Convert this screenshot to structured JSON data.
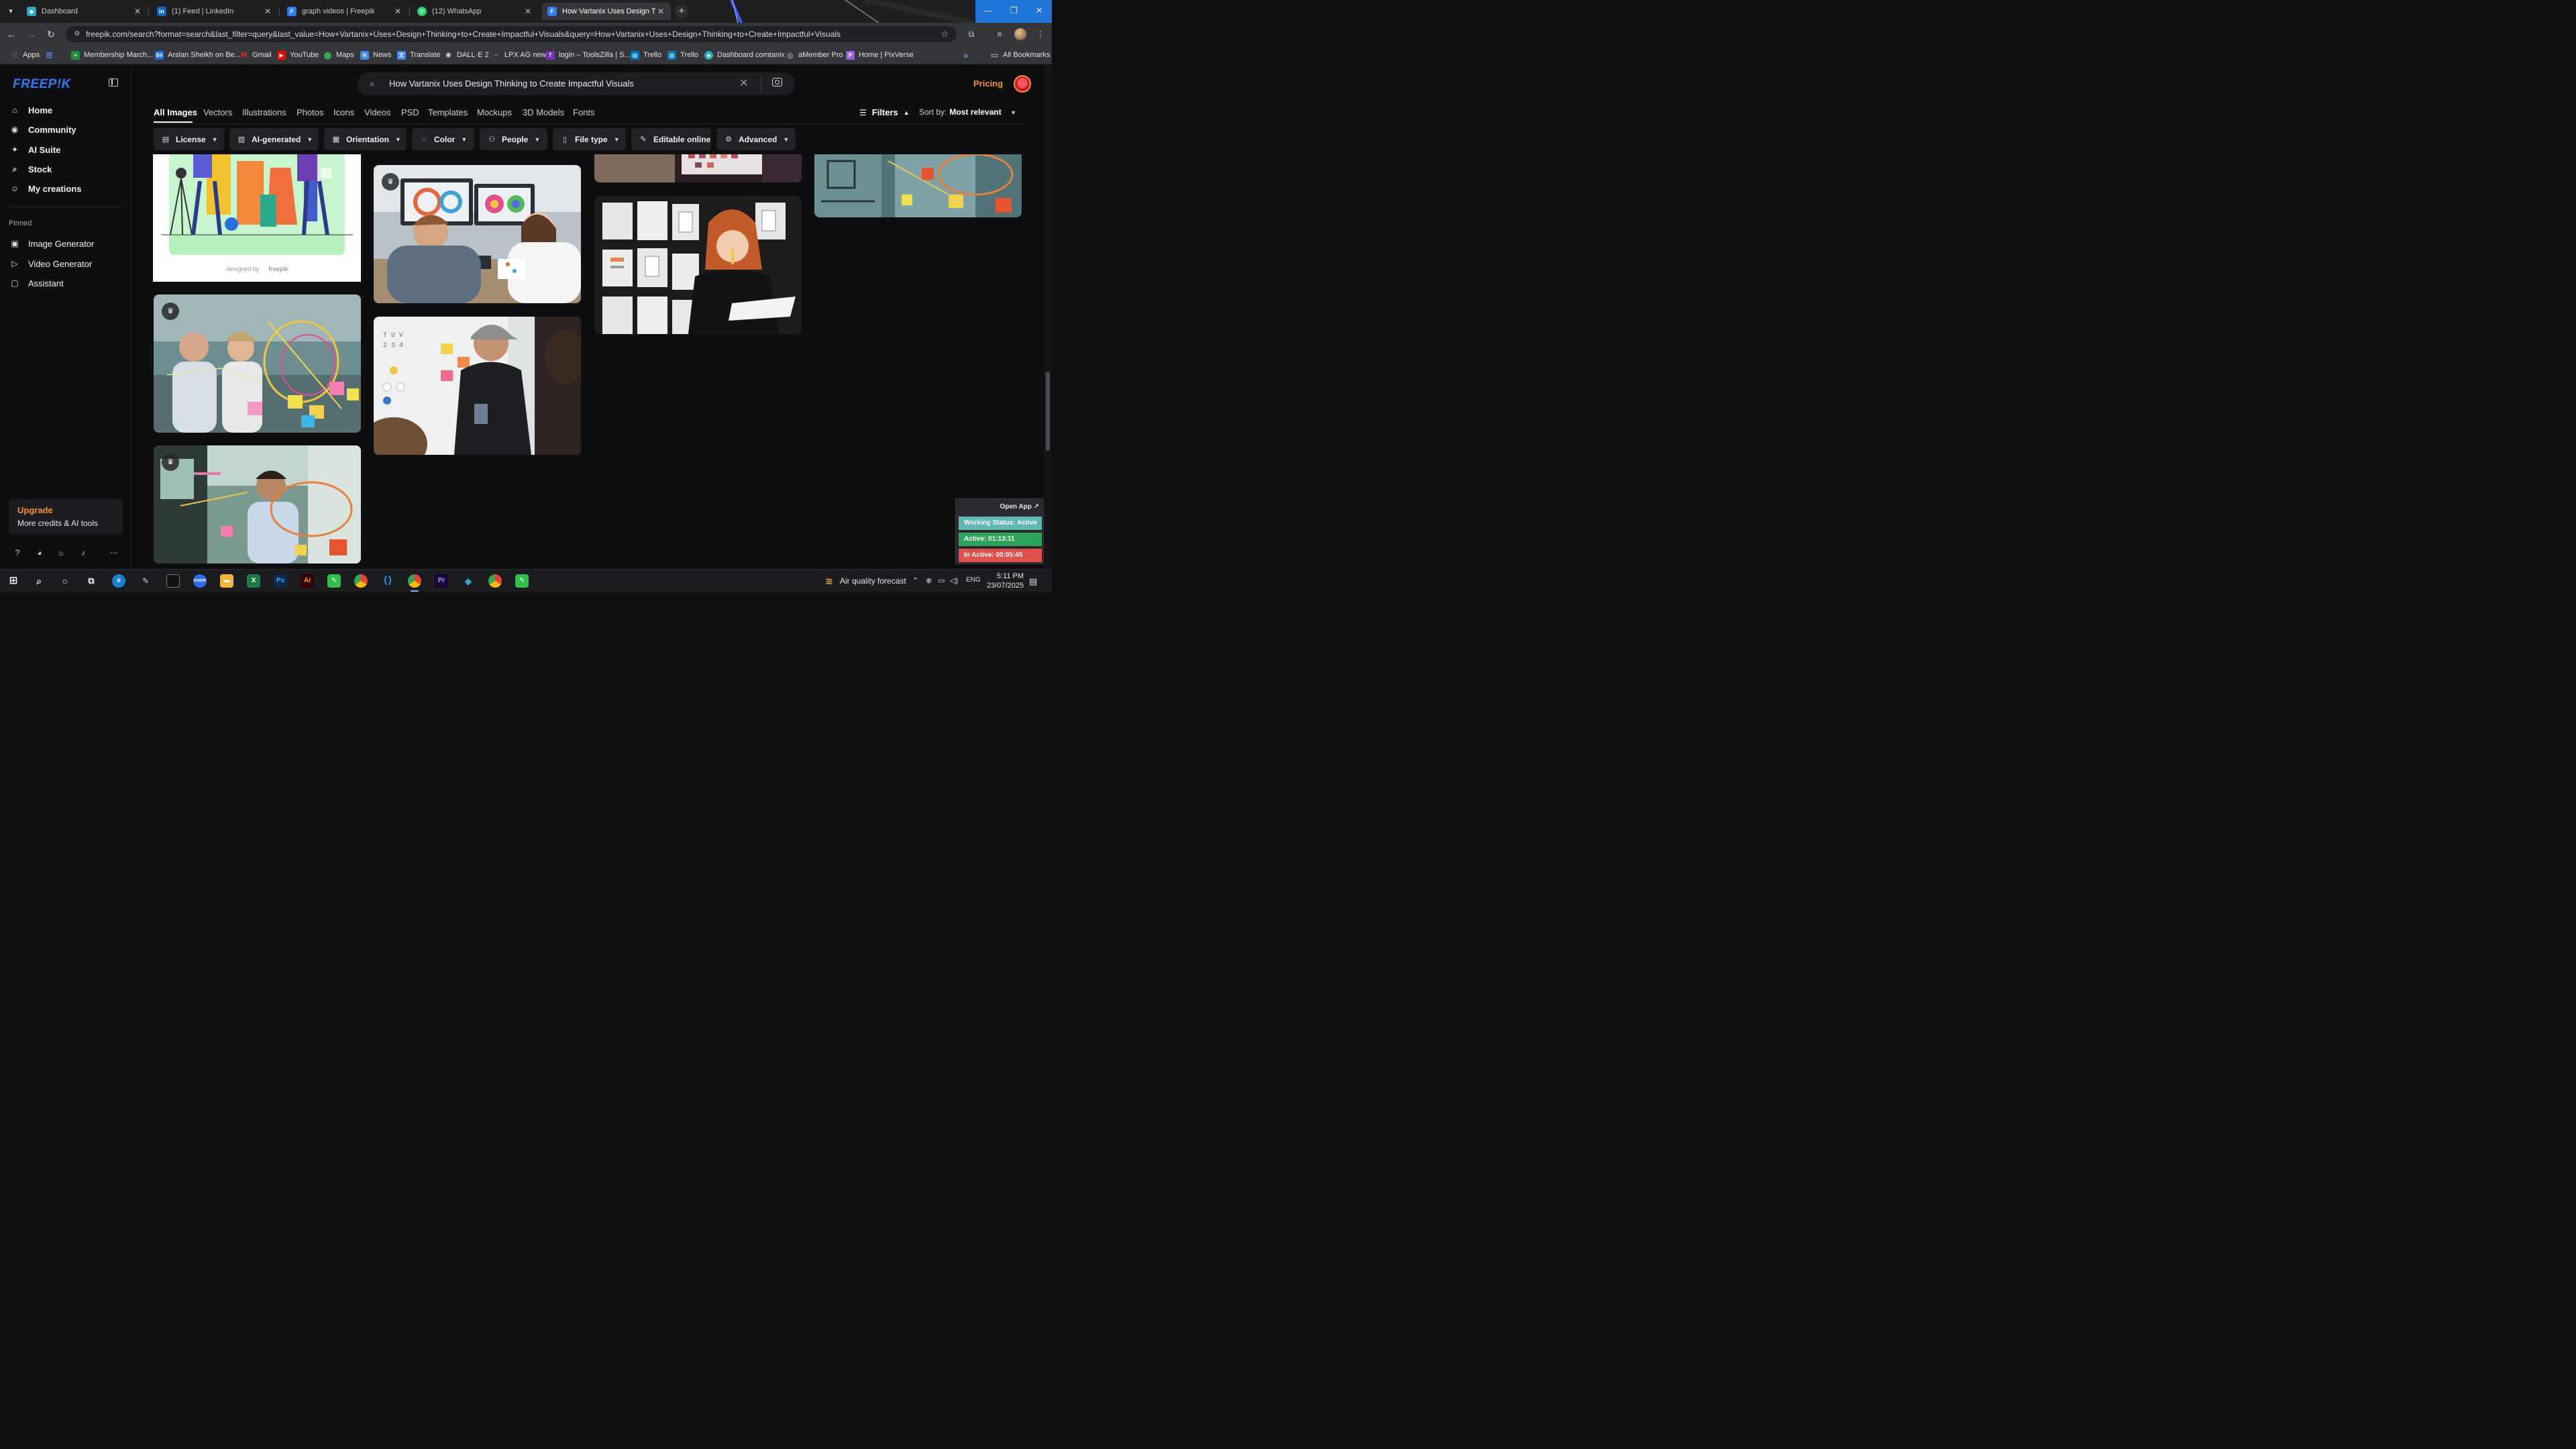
{
  "browser": {
    "tabs": [
      {
        "title": "Dashboard",
        "favicon_color": "#2aa9c9",
        "active": false
      },
      {
        "title": "(1) Feed | LinkedIn",
        "favicon_color": "#0a66c2",
        "active": false
      },
      {
        "title": "graph videos | Freepik",
        "favicon_color": "#2f7cf6",
        "active": false
      },
      {
        "title": "(12) WhatsApp",
        "favicon_color": "#25d366",
        "active": false
      },
      {
        "title": "How Vartanix Uses Design Thinking",
        "favicon_color": "#2f7cf6",
        "active": true
      }
    ],
    "url": "freepik.com/search?format=search&last_filter=query&last_value=How+Vartanix+Uses+Design+Thinking+to+Create+Impactful+Visuals&query=How+Vartanix+Uses+Design+Thinking+to+Create+Impactful+Visuals",
    "bookmarks": [
      {
        "label": "Apps",
        "color": "#3d7cf5"
      },
      {
        "label": "",
        "color": "#5a8df5"
      },
      {
        "label": "Membership March...",
        "color": "#1e8e3e"
      },
      {
        "label": "Arslan Sheikh on Be...",
        "color": "#1769ff"
      },
      {
        "label": "Gmail",
        "color": "#d93025"
      },
      {
        "label": "YouTube",
        "color": "#ff0000"
      },
      {
        "label": "Maps",
        "color": "#34a853"
      },
      {
        "label": "News",
        "color": "#4285f4"
      },
      {
        "label": "Translate",
        "color": "#4285f4"
      },
      {
        "label": "DALL·E 2",
        "color": "#555555"
      },
      {
        "label": "LPX AG new",
        "color": "#777777"
      },
      {
        "label": "login – ToolsZilla | S...",
        "color": "#7b2cbf"
      },
      {
        "label": "Trello",
        "color": "#0079bf"
      },
      {
        "label": "Trello",
        "color": "#0079bf"
      },
      {
        "label": "Dashboard comtanix",
        "color": "#2aa9c9"
      },
      {
        "label": "aMember Pro",
        "color": "#888888"
      },
      {
        "label": "Home | PixVerse",
        "color": "#9b5de5"
      }
    ],
    "all_bookmarks": "All Bookmarks"
  },
  "sidebar": {
    "logo": "FREEP!K",
    "nav": [
      {
        "label": "Home",
        "icon": "home-icon"
      },
      {
        "label": "Community",
        "icon": "globe-icon"
      },
      {
        "label": "AI Suite",
        "icon": "sparkle-icon"
      },
      {
        "label": "Stock",
        "icon": "search-icon"
      },
      {
        "label": "My creations",
        "icon": "user-icon"
      }
    ],
    "pinned_label": "Pinned",
    "pinned": [
      {
        "label": "Image Generator",
        "icon": "image-icon"
      },
      {
        "label": "Video Generator",
        "icon": "video-icon"
      },
      {
        "label": "Assistant",
        "icon": "chat-icon"
      }
    ],
    "upgrade_title": "Upgrade",
    "upgrade_subtitle": "More credits & AI tools"
  },
  "header": {
    "search_query": "How Vartanix Uses Design Thinking to Create Impactful Visuals",
    "pricing": "Pricing"
  },
  "type_tabs": [
    "All Images",
    "Vectors",
    "Illustrations",
    "Photos",
    "Icons",
    "Videos",
    "PSD",
    "Templates",
    "Mockups",
    "3D Models",
    "Fonts"
  ],
  "filters_label": "Filters",
  "sort_label": "Sort by:",
  "sort_value": "Most relevant",
  "filters": [
    {
      "label": "License",
      "icon": "license-icon"
    },
    {
      "label": "AI-generated",
      "icon": "ai-icon"
    },
    {
      "label": "Orientation",
      "icon": "orientation-icon"
    },
    {
      "label": "Color",
      "icon": "palette-icon"
    },
    {
      "label": "People",
      "icon": "people-icon"
    },
    {
      "label": "File type",
      "icon": "file-icon"
    },
    {
      "label": "Editable online",
      "icon": "brush-icon"
    },
    {
      "label": "Advanced",
      "icon": "gear-icon"
    }
  ],
  "results": {
    "illustration_credit": "designed by",
    "illustration_brand": "freepik"
  },
  "tracker": {
    "open_app": "Open App ↗",
    "working_status": "Working Status: Active",
    "active": "Active: 01:13:11",
    "inactive": "In Active: 00:05:45"
  },
  "taskbar": {
    "air_quality": "Air quality forecast",
    "language": "ENG",
    "time": "5:11 PM",
    "date": "23/07/2025"
  }
}
